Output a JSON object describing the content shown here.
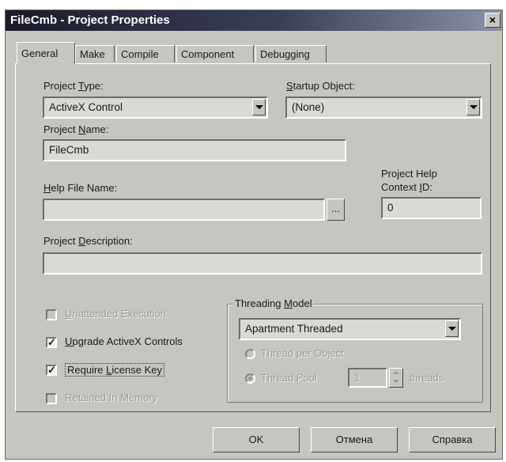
{
  "window": {
    "title": "FileCmb - Project Properties",
    "close_label": "×"
  },
  "tabs": [
    {
      "label": "General",
      "active": true
    },
    {
      "label": "Make"
    },
    {
      "label": "Compile"
    },
    {
      "label": "Component"
    },
    {
      "label": "Debugging"
    }
  ],
  "project_type": {
    "label_pre": "Project ",
    "label_key": "T",
    "label_post": "ype:",
    "value": "ActiveX Control"
  },
  "startup_object": {
    "label_key": "S",
    "label_post": "tartup Object:",
    "value": "(None)"
  },
  "project_name": {
    "label_pre": "Project ",
    "label_key": "N",
    "label_post": "ame:",
    "value": "FileCmb"
  },
  "help_file": {
    "label_key": "H",
    "label_post": "elp File Name:",
    "value": "",
    "browse_label": "..."
  },
  "help_context": {
    "label_line1": "Project Help",
    "label_line2_pre": "Context ",
    "label_line2_key": "I",
    "label_line2_post": "D:",
    "value": "0"
  },
  "project_description": {
    "label_pre": "Project ",
    "label_key": "D",
    "label_post": "escription:",
    "value": ""
  },
  "checkboxes": {
    "unattended": {
      "label_key": "U",
      "label_post": "nattended Execution",
      "checked": false,
      "enabled": false
    },
    "upgrade": {
      "label_key": "U",
      "label_post": "pgrade ActiveX Controls",
      "checked": true,
      "enabled": true,
      "mark": "✓"
    },
    "license": {
      "label_pre": "Require ",
      "label_key": "L",
      "label_post": "icense Key",
      "checked": true,
      "enabled": true,
      "mark": "✓"
    },
    "retained": {
      "label": "Retained In Memory",
      "checked": false,
      "enabled": false
    }
  },
  "threading": {
    "title_pre": "Threading ",
    "title_key": "M",
    "title_post": "odel",
    "value": "Apartment Threaded",
    "per_object_label": "Thread per Object",
    "pool_label": "Thread Pool",
    "pool_count": "1",
    "threads_label": "threads"
  },
  "buttons": {
    "ok": "OK",
    "cancel": "Отмена",
    "help": "Справка"
  }
}
